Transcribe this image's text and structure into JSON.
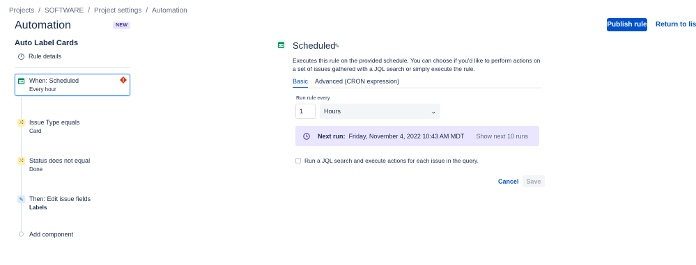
{
  "breadcrumb": [
    "Projects",
    "SOFTWARE",
    "Project settings",
    "Automation"
  ],
  "breadcrumb_separator": "/",
  "header": {
    "title": "Automation",
    "badge": "NEW",
    "publish_label": "Publish rule",
    "return_label": "Return to list"
  },
  "rule": {
    "name": "Auto Label Cards",
    "details_label": "Rule details",
    "info_icon": "i",
    "steps": [
      {
        "title": "When: Scheduled",
        "subtitle": "Every hour",
        "icon": "calendar-icon",
        "has_error": true
      },
      {
        "title": "Issue Type equals",
        "subtitle": "Card",
        "icon": "shuffle-icon"
      },
      {
        "title": "Status does not equal",
        "subtitle": "Done",
        "icon": "shuffle-icon"
      },
      {
        "title": "Then: Edit issue fields",
        "subtitle": "Labels",
        "icon": "pencil-icon"
      }
    ],
    "add_component_label": "Add component"
  },
  "panel": {
    "title": "Scheduled",
    "description": "Executes this rule on the provided schedule. You can choose if you'd like to perform actions on a set of issues gathered with a JQL search or simply execute the rule.",
    "tabs": [
      "Basic",
      "Advanced (CRON expression)"
    ],
    "active_tab": "Basic",
    "run_every_label": "Run rule every",
    "run_every_value": "1",
    "run_every_unit": "Hours",
    "next_run_label": "Next run:",
    "next_run_value": "Friday, November 4, 2022 10:43 AM MDT",
    "show_next_label": "Show next 10 runs",
    "jql_checkbox_label": "Run a JQL search and execute actions for each issue in the query.",
    "jql_checked": false,
    "cancel_label": "Cancel",
    "save_label": "Save"
  },
  "colors": {
    "accent": "#0052CC",
    "next_run_bg": "#EAE6FF",
    "error": "#DE350B"
  }
}
